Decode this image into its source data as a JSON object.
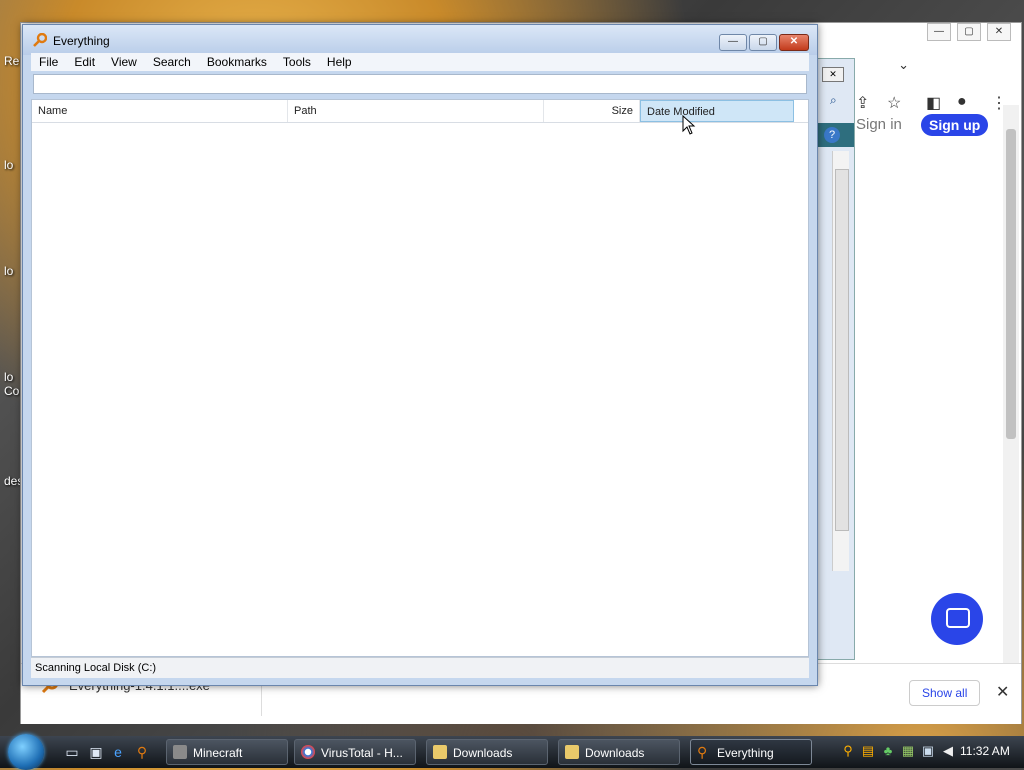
{
  "desktop": {
    "labels": [
      "Re",
      "lo",
      "lo",
      "lo",
      "Co",
      "des"
    ]
  },
  "browser": {
    "caption": {
      "min": "—",
      "max": "▢",
      "close": "✕"
    },
    "signin": "Sign in",
    "signup": "Sign up",
    "download": {
      "filename": "Everything-1.4.1.1....exe",
      "show_all": "Show all",
      "close": "✕"
    }
  },
  "everything": {
    "title": "Everything",
    "menu": [
      "File",
      "Edit",
      "View",
      "Search",
      "Bookmarks",
      "Tools",
      "Help"
    ],
    "search_value": "",
    "columns": {
      "name": "Name",
      "path": "Path",
      "size": "Size",
      "date": "Date Modified"
    },
    "status": "Scanning Local Disk (C:)",
    "caption": {
      "min": "—",
      "max": "▢",
      "close": "✕"
    }
  },
  "taskbar": {
    "buttons": [
      {
        "label": "Minecraft",
        "icon": "minecraft-icon"
      },
      {
        "label": "VirusTotal - H...",
        "icon": "chrome-icon"
      },
      {
        "label": "Downloads",
        "icon": "folder-icon"
      },
      {
        "label": "Downloads",
        "icon": "folder-icon"
      },
      {
        "label": "Everything",
        "icon": "everything-icon",
        "active": true
      }
    ],
    "clock": "11:32 AM"
  }
}
